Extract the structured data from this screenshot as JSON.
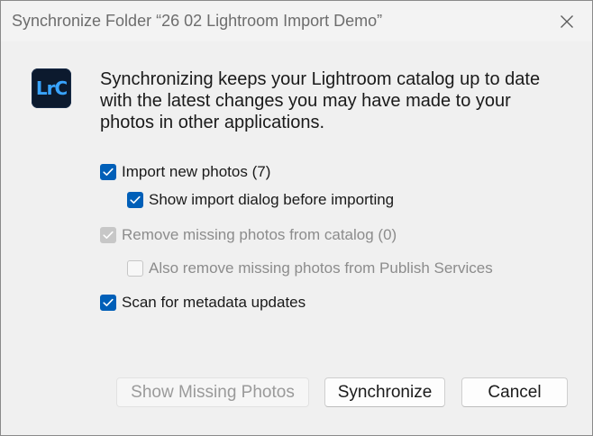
{
  "window": {
    "title": "Synchronize Folder “26 02 Lightroom Import Demo”",
    "close_icon": "close-icon"
  },
  "app_logo": {
    "text": "LrC",
    "icon": "lightroom-classic-logo",
    "background": "#0c1a2e",
    "accent": "#39a4ff"
  },
  "description": "Synchronizing keeps your Lightroom catalog up to date with the latest changes you may have made to your photos in other applications.",
  "options": {
    "import_new": {
      "label": "Import new photos (7)",
      "checked": true,
      "enabled": true
    },
    "show_import_dialog": {
      "label": "Show import dialog before importing",
      "checked": true,
      "enabled": true
    },
    "remove_missing": {
      "label": "Remove missing photos from catalog (0)",
      "checked": true,
      "enabled": false
    },
    "also_remove_publish": {
      "label": "Also remove missing photos from Publish Services",
      "checked": false,
      "enabled": false
    },
    "scan_metadata": {
      "label": "Scan for metadata updates",
      "checked": true,
      "enabled": true
    }
  },
  "buttons": {
    "show_missing": {
      "label": "Show Missing Photos",
      "enabled": false
    },
    "synchronize": {
      "label": "Synchronize",
      "enabled": true
    },
    "cancel": {
      "label": "Cancel",
      "enabled": true
    }
  },
  "colors": {
    "checkbox_checked": "#005fb8",
    "checkbox_disabled": "#c7c7c7",
    "dialog_background": "#f0f0f0"
  }
}
